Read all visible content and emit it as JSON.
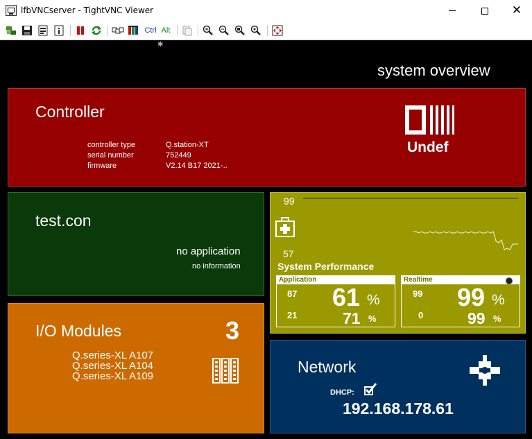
{
  "window": {
    "title": "lfbVNCserver - TightVNC Viewer",
    "minimize_glyph": "",
    "close_glyph": "✕"
  },
  "toolbar": {
    "items": [
      {
        "name": "new-connection-icon"
      },
      {
        "name": "save-icon"
      },
      {
        "name": "options-icon"
      },
      {
        "name": "info-icon"
      },
      {
        "name": "pause-icon"
      },
      {
        "name": "refresh-icon"
      },
      {
        "name": "ctrl-alt-del-icon"
      },
      {
        "name": "ctrl-esc-icon"
      },
      {
        "name": "ctrl-key",
        "label": "Ctrl"
      },
      {
        "name": "alt-key",
        "label": "Alt"
      },
      {
        "name": "clipboard-icon"
      },
      {
        "name": "zoom-in-icon"
      },
      {
        "name": "zoom-out-icon"
      },
      {
        "name": "zoom-100-icon"
      },
      {
        "name": "zoom-fit-icon"
      },
      {
        "name": "fullscreen-icon"
      }
    ]
  },
  "screen": {
    "title": "system overview",
    "controller": {
      "title": "Controller",
      "labels": [
        "controller type",
        "serial number",
        "firmware"
      ],
      "values": [
        "Q.station-XT",
        "752449",
        "V2.14 B17 2021-.."
      ],
      "status": "Undef"
    },
    "application": {
      "title": "test.con",
      "status": "no application",
      "info": "no information"
    },
    "performance": {
      "label": "System Performance",
      "max": "99",
      "min": "57",
      "history": [
        99,
        99,
        99,
        99,
        99,
        99,
        99,
        99,
        99,
        99,
        99,
        99,
        99,
        99,
        99,
        99,
        99,
        99,
        99,
        99,
        99,
        99,
        99,
        99,
        99,
        99,
        99,
        99,
        99,
        99,
        99,
        99,
        99,
        99,
        99,
        99,
        99,
        99,
        99,
        99,
        75,
        75,
        74,
        75,
        74,
        74,
        75,
        74,
        75,
        74,
        74,
        75,
        74,
        75,
        74,
        74,
        75,
        74,
        74,
        75,
        74,
        75,
        74,
        74,
        75,
        74,
        74,
        75,
        74,
        75,
        68,
        67,
        69,
        62,
        63,
        62,
        66,
        66,
        66
      ],
      "application": {
        "header": "Application",
        "top_left": "87",
        "top_value": "61",
        "bottom_left": "21",
        "bottom_value": "71",
        "unit": "%"
      },
      "realtime": {
        "header": "Realtime",
        "top_left": "99",
        "top_value": "99",
        "bottom_left": "0",
        "bottom_value": "99",
        "unit": "%"
      }
    },
    "io": {
      "title": "I/O Modules",
      "count": "3",
      "modules": [
        "Q.series-XL A107",
        "Q.series-XL A104",
        "Q.series-XL A109"
      ]
    },
    "network": {
      "title": "Network",
      "dhcp_label": "DHCP:",
      "dhcp_enabled": true,
      "ip": "192.168.178.61"
    }
  }
}
